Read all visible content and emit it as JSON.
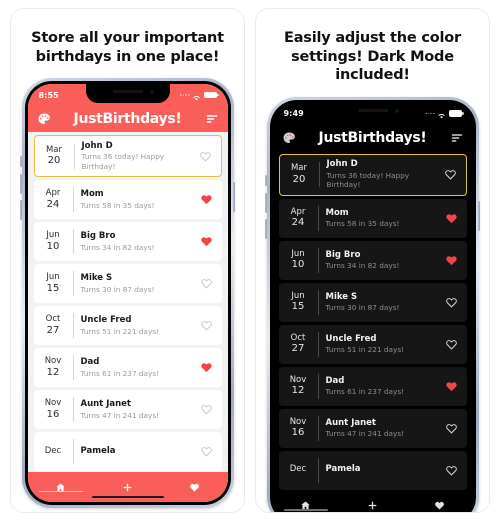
{
  "app": {
    "name": "JustBirthdays!",
    "accent_color": "#FA5E5B",
    "highlight_border_color": "#E3C141",
    "heart_filled_color": "#F3444B"
  },
  "panels": [
    {
      "id": "light",
      "caption": "Store all your important\nbirthdays in one place!",
      "theme": "light",
      "status_bar": {
        "time": "8:55",
        "signal_icon": "signal-dots-icon",
        "wifi_icon": "wifi-icon",
        "battery_icon": "battery-icon"
      },
      "header": {
        "left_icon": "palette-icon",
        "title": "JustBirthdays!",
        "right_icon": "sort-icon"
      },
      "rows": [
        {
          "month": "Mar",
          "day": "20",
          "name": "John D",
          "detail": "Turns 36 today! Happy Birthday!",
          "favorite": false,
          "highlighted": true
        },
        {
          "month": "Apr",
          "day": "24",
          "name": "Mom",
          "detail": "Turns 58 in 35 days!",
          "favorite": true,
          "highlighted": false
        },
        {
          "month": "Jun",
          "day": "10",
          "name": "Big Bro",
          "detail": "Turns 34 in 82 days!",
          "favorite": true,
          "highlighted": false
        },
        {
          "month": "Jun",
          "day": "15",
          "name": "Mike S",
          "detail": "Turns 30 in 87 days!",
          "favorite": false,
          "highlighted": false
        },
        {
          "month": "Oct",
          "day": "27",
          "name": "Uncle Fred",
          "detail": "Turns 51 in 221 days!",
          "favorite": false,
          "highlighted": false
        },
        {
          "month": "Nov",
          "day": "12",
          "name": "Dad",
          "detail": "Turns 61 in 237 days!",
          "favorite": true,
          "highlighted": false
        },
        {
          "month": "Nov",
          "day": "16",
          "name": "Aunt Janet",
          "detail": "Turns 47 in 241 days!",
          "favorite": false,
          "highlighted": false
        },
        {
          "month": "Dec",
          "day": "",
          "name": "Pamela",
          "detail": "",
          "favorite": false,
          "highlighted": false
        }
      ],
      "tabs": [
        {
          "icon": "home-icon",
          "selected": true
        },
        {
          "icon": "plus-icon",
          "selected": false
        },
        {
          "icon": "heart-icon",
          "selected": false
        }
      ]
    },
    {
      "id": "dark",
      "caption": "Easily adjust the color\nsettings! Dark Mode included!",
      "theme": "dark",
      "status_bar": {
        "time": "9:49",
        "signal_icon": "signal-dots-icon",
        "wifi_icon": "wifi-icon",
        "battery_icon": "battery-icon"
      },
      "header": {
        "left_icon": "palette-icon",
        "title": "JustBirthdays!",
        "right_icon": "sort-icon"
      },
      "rows": [
        {
          "month": "Mar",
          "day": "20",
          "name": "John D",
          "detail": "Turns 36 today! Happy Birthday!",
          "favorite": false,
          "highlighted": true
        },
        {
          "month": "Apr",
          "day": "24",
          "name": "Mom",
          "detail": "Turns 58 in 35 days!",
          "favorite": true,
          "highlighted": false
        },
        {
          "month": "Jun",
          "day": "10",
          "name": "Big Bro",
          "detail": "Turns 34 in 82 days!",
          "favorite": true,
          "highlighted": false
        },
        {
          "month": "Jun",
          "day": "15",
          "name": "Mike S",
          "detail": "Turns 30 in 87 days!",
          "favorite": false,
          "highlighted": false
        },
        {
          "month": "Oct",
          "day": "27",
          "name": "Uncle Fred",
          "detail": "Turns 51 in 221 days!",
          "favorite": false,
          "highlighted": false
        },
        {
          "month": "Nov",
          "day": "12",
          "name": "Dad",
          "detail": "Turns 61 in 237 days!",
          "favorite": true,
          "highlighted": false
        },
        {
          "month": "Nov",
          "day": "16",
          "name": "Aunt Janet",
          "detail": "Turns 47 in 241 days!",
          "favorite": false,
          "highlighted": false
        },
        {
          "month": "Dec",
          "day": "",
          "name": "Pamela",
          "detail": "",
          "favorite": false,
          "highlighted": false
        }
      ],
      "tabs": [
        {
          "icon": "home-icon",
          "selected": true
        },
        {
          "icon": "plus-icon",
          "selected": false
        },
        {
          "icon": "heart-icon",
          "selected": false
        }
      ]
    }
  ]
}
